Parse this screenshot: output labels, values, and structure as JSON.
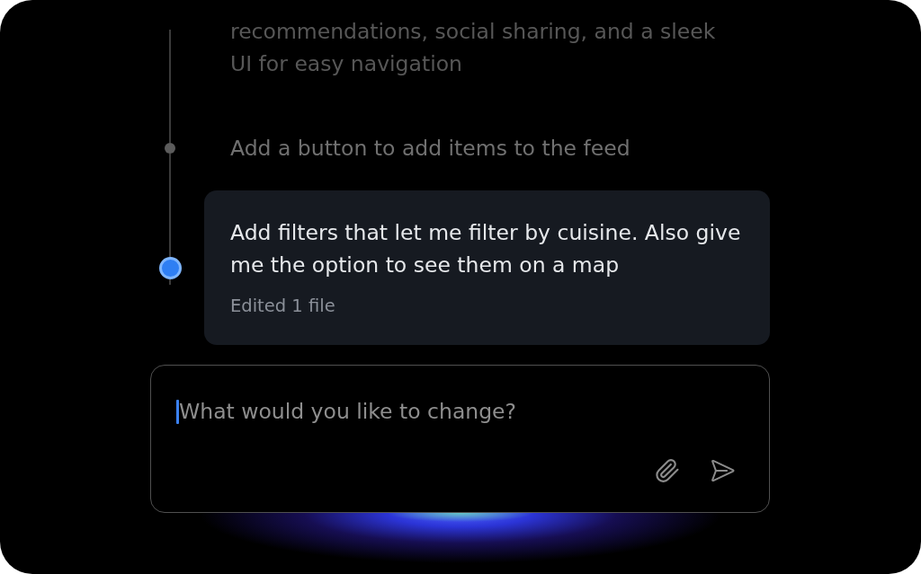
{
  "timeline": {
    "items": [
      {
        "kind": "faded",
        "text": "recommendations, social sharing, and a sleek UI for easy navigation",
        "selected": false
      },
      {
        "kind": "message",
        "text": "Add a button to add items to the feed",
        "selected": false
      },
      {
        "kind": "message",
        "text": "Add filters that let me filter by cuisine. Also give me the option to see them on a map",
        "selected": true,
        "detail": "Edited 1 file"
      }
    ]
  },
  "composer": {
    "placeholder": "What would you like to change?",
    "focused": true
  }
}
